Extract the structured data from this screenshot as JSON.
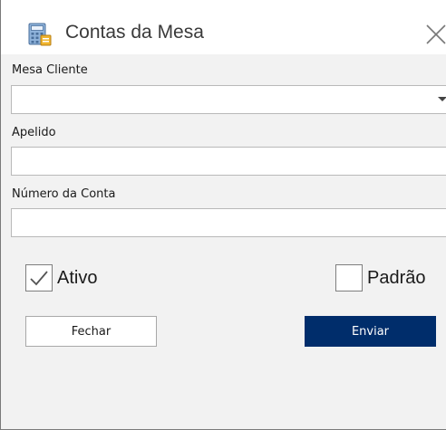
{
  "window": {
    "title": "Contas da Mesa",
    "icon": "calculator-icon",
    "close_icon": "close-icon"
  },
  "form": {
    "mesa_cliente": {
      "label": "Mesa Cliente",
      "value": ""
    },
    "apelido": {
      "label": "Apelido",
      "value": "",
      "placeholder": ""
    },
    "numero_conta": {
      "label": "Número da Conta",
      "value": "",
      "placeholder": ""
    }
  },
  "checkboxes": {
    "ativo": {
      "label": "Ativo",
      "checked": true
    },
    "padrao": {
      "label": "Padrão",
      "checked": false
    }
  },
  "buttons": {
    "fechar": "Fechar",
    "enviar": "Enviar"
  },
  "colors": {
    "primary": "#002d6b",
    "window_bg": "#f2f2f2",
    "border": "#b9b9b9"
  }
}
